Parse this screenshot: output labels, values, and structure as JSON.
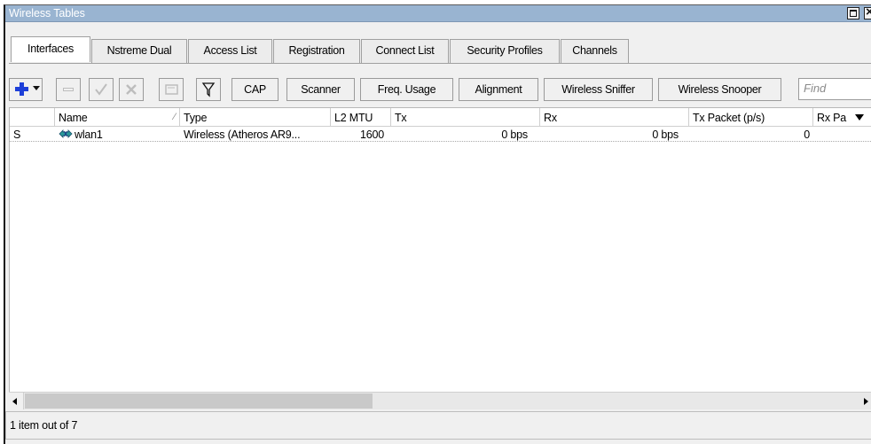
{
  "window": {
    "title": "Wireless Tables"
  },
  "tabs": [
    {
      "label": "Interfaces",
      "active": true
    },
    {
      "label": "Nstreme Dual",
      "active": false
    },
    {
      "label": "Access List",
      "active": false
    },
    {
      "label": "Registration",
      "active": false
    },
    {
      "label": "Connect List",
      "active": false
    },
    {
      "label": "Security Profiles",
      "active": false
    },
    {
      "label": "Channels",
      "active": false
    }
  ],
  "toolbar": {
    "cap": "CAP",
    "scanner": "Scanner",
    "freq_usage": "Freq. Usage",
    "alignment": "Alignment",
    "wireless_sniffer": "Wireless Sniffer",
    "wireless_snooper": "Wireless Snooper",
    "find_placeholder": "Find"
  },
  "table": {
    "columns": [
      "",
      "Name",
      "Type",
      "L2 MTU",
      "Tx",
      "Rx",
      "Tx Packet (p/s)",
      "Rx Pa"
    ],
    "rows": [
      {
        "flag": "S",
        "name": "wlan1",
        "type": "Wireless (Atheros AR9...",
        "l2mtu": "1600",
        "tx": "0 bps",
        "rx": "0 bps",
        "tx_packet": "0",
        "rx_packet": ""
      }
    ]
  },
  "status": {
    "text": "1 item out of 7"
  },
  "colors": {
    "titlebar": "#99b4d1",
    "add_icon": "#1d3fd8"
  }
}
